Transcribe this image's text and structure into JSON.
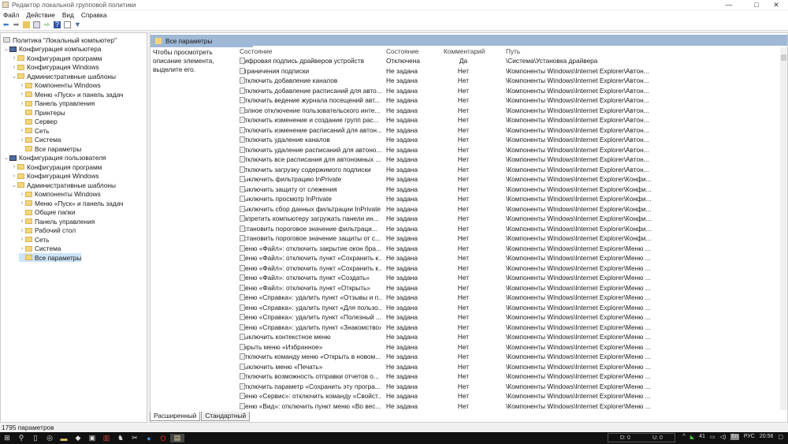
{
  "window": {
    "title": "Редактор локальной групповой политики",
    "minimize": "—",
    "maximize": "□",
    "close": "✕"
  },
  "menu": [
    "Файл",
    "Действие",
    "Вид",
    "Справка"
  ],
  "toolbar": {
    "icons": [
      "back-icon",
      "forward-icon",
      "up-folder-icon",
      "show-hide-tree-icon",
      "export-icon",
      "help-icon",
      "properties-icon",
      "filter-icon"
    ]
  },
  "tree": [
    {
      "label": "Политика \"Локальный компьютер\"",
      "level": 0,
      "arrow": ""
    },
    {
      "label": "Конфигурация компьютера",
      "level": 0,
      "arrow": "⌄"
    },
    {
      "label": "Конфигурация программ",
      "level": 1,
      "arrow": "›"
    },
    {
      "label": "Конфигурация Windows",
      "level": 1,
      "arrow": "›"
    },
    {
      "label": "Административные шаблоны",
      "level": 1,
      "arrow": "⌄"
    },
    {
      "label": "Компоненты Windows",
      "level": 2,
      "arrow": "›"
    },
    {
      "label": "Меню «Пуск» и панель задач",
      "level": 2,
      "arrow": "›"
    },
    {
      "label": "Панель управления",
      "level": 2,
      "arrow": "›"
    },
    {
      "label": "Принтеры",
      "level": 2,
      "arrow": ""
    },
    {
      "label": "Сервер",
      "level": 2,
      "arrow": ""
    },
    {
      "label": "Сеть",
      "level": 2,
      "arrow": "›"
    },
    {
      "label": "Система",
      "level": 2,
      "arrow": "›"
    },
    {
      "label": "Все параметры",
      "level": 2,
      "arrow": ""
    },
    {
      "label": "Конфигурация пользователя",
      "level": 0,
      "arrow": "⌄"
    },
    {
      "label": "Конфигурация программ",
      "level": 1,
      "arrow": "›"
    },
    {
      "label": "Конфигурация Windows",
      "level": 1,
      "arrow": "›"
    },
    {
      "label": "Административные шаблоны",
      "level": 1,
      "arrow": "⌄"
    },
    {
      "label": "Компоненты Windows",
      "level": 2,
      "arrow": "›"
    },
    {
      "label": "Меню «Пуск» и панель задач",
      "level": 2,
      "arrow": "›"
    },
    {
      "label": "Общие папки",
      "level": 2,
      "arrow": ""
    },
    {
      "label": "Панель управления",
      "level": 2,
      "arrow": "›"
    },
    {
      "label": "Рабочий стол",
      "level": 2,
      "arrow": "›"
    },
    {
      "label": "Сеть",
      "level": 2,
      "arrow": "›"
    },
    {
      "label": "Система",
      "level": 2,
      "arrow": "›"
    },
    {
      "label": "Все параметры",
      "level": 2,
      "arrow": "",
      "selected": true
    }
  ],
  "panel": {
    "header": "Все параметры",
    "description": "Чтобы просмотреть описание элемента, выделите его."
  },
  "columns": [
    "Состояние",
    "Состояние",
    "Комментарий",
    "Путь"
  ],
  "rows": [
    [
      "Цифровая подпись драйверов устройств",
      "Отключена",
      "Да",
      "\\Система\\Установка драйвера"
    ],
    [
      "Ограничения подписки",
      "Не задана",
      "Нет",
      "\\Компоненты Windows\\Internet Explorer\\Автон..."
    ],
    [
      "Отключить добавление каналов",
      "Не задана",
      "Нет",
      "\\Компоненты Windows\\Internet Explorer\\Автон..."
    ],
    [
      "Отключить добавление расписаний для авто...",
      "Не задана",
      "Нет",
      "\\Компоненты Windows\\Internet Explorer\\Автон..."
    ],
    [
      "Отключить ведение журнала посещений авт...",
      "Не задана",
      "Нет",
      "\\Компоненты Windows\\Internet Explorer\\Автон..."
    ],
    [
      "Полное отключение пользовательского инте...",
      "Не задана",
      "Нет",
      "\\Компоненты Windows\\Internet Explorer\\Автон..."
    ],
    [
      "Отключить изменение и создание групп рас...",
      "Не задана",
      "Нет",
      "\\Компоненты Windows\\Internet Explorer\\Автон..."
    ],
    [
      "Отключить изменение расписаний для автон...",
      "Не задана",
      "Нет",
      "\\Компоненты Windows\\Internet Explorer\\Автон..."
    ],
    [
      "Отключить удаление каналов",
      "Не задана",
      "Нет",
      "\\Компоненты Windows\\Internet Explorer\\Автон..."
    ],
    [
      "Отключить удаление расписаний для автоно...",
      "Не задана",
      "Нет",
      "\\Компоненты Windows\\Internet Explorer\\Автон..."
    ],
    [
      "Отключить все расписания для автономных ...",
      "Не задана",
      "Нет",
      "\\Компоненты Windows\\Internet Explorer\\Автон..."
    ],
    [
      "Отключить загрузку содержимого подписки",
      "Не задана",
      "Нет",
      "\\Компоненты Windows\\Internet Explorer\\Автон..."
    ],
    [
      "Выключить фильтрацию InPrivate",
      "Не задана",
      "Нет",
      "\\Компоненты Windows\\Internet Explorer\\Конфи..."
    ],
    [
      "Выключить защиту от слежения",
      "Не задана",
      "Нет",
      "\\Компоненты Windows\\Internet Explorer\\Конфи..."
    ],
    [
      "Выключить просмотр InPrivate",
      "Не задана",
      "Нет",
      "\\Компоненты Windows\\Internet Explorer\\Конфи..."
    ],
    [
      "Выключить сбор данных фильтрации InPrivate",
      "Не задана",
      "Нет",
      "\\Компоненты Windows\\Internet Explorer\\Конфи..."
    ],
    [
      "Запретить компьютеру загружать панели ин...",
      "Не задана",
      "Нет",
      "\\Компоненты Windows\\Internet Explorer\\Конфи..."
    ],
    [
      "Установить пороговое значение фильтраци...",
      "Не задана",
      "Нет",
      "\\Компоненты Windows\\Internet Explorer\\Конфи..."
    ],
    [
      "Установить пороговое значение защиты от с...",
      "Не задана",
      "Нет",
      "\\Компоненты Windows\\Internet Explorer\\Конфи..."
    ],
    [
      "Меню «Файл»: отключить закрытие окон бра...",
      "Не задана",
      "Нет",
      "\\Компоненты Windows\\Internet Explorer\\Меню ..."
    ],
    [
      "Меню «Файл»: отключить пункт «Сохранить к...",
      "Не задана",
      "Нет",
      "\\Компоненты Windows\\Internet Explorer\\Меню ..."
    ],
    [
      "Меню «Файл»: отключить пункт «Сохранить к...",
      "Не задана",
      "Нет",
      "\\Компоненты Windows\\Internet Explorer\\Меню ..."
    ],
    [
      "Меню «Файл»: отключить пункт «Создать»",
      "Не задана",
      "Нет",
      "\\Компоненты Windows\\Internet Explorer\\Меню ..."
    ],
    [
      "Меню «Файл»: отключить пункт «Открыть»",
      "Не задана",
      "Нет",
      "\\Компоненты Windows\\Internet Explorer\\Меню ..."
    ],
    [
      "Меню «Справка»: удалить пункт «Отзывы и п...",
      "Не задана",
      "Нет",
      "\\Компоненты Windows\\Internet Explorer\\Меню ..."
    ],
    [
      "Меню «Справка»: удалить пункт «Для пользо...",
      "Не задана",
      "Нет",
      "\\Компоненты Windows\\Internet Explorer\\Меню ..."
    ],
    [
      "Меню «Справка»: удалить пункт «Полезный ...",
      "Не задана",
      "Нет",
      "\\Компоненты Windows\\Internet Explorer\\Меню ..."
    ],
    [
      "Меню «Справка»: удалить пункт «Знакомство»",
      "Не задана",
      "Нет",
      "\\Компоненты Windows\\Internet Explorer\\Меню ..."
    ],
    [
      "Выключить контекстное меню",
      "Не задана",
      "Нет",
      "\\Компоненты Windows\\Internet Explorer\\Меню ..."
    ],
    [
      "Скрыть меню «Избранное»",
      "Не задана",
      "Нет",
      "\\Компоненты Windows\\Internet Explorer\\Меню ..."
    ],
    [
      "Отключить команду меню «Открыть в новом...",
      "Не задана",
      "Нет",
      "\\Компоненты Windows\\Internet Explorer\\Меню ..."
    ],
    [
      "Выключить меню «Печать»",
      "Не задана",
      "Нет",
      "\\Компоненты Windows\\Internet Explorer\\Меню ..."
    ],
    [
      "Отключить возможность отправки отчетов о...",
      "Не задана",
      "Нет",
      "\\Компоненты Windows\\Internet Explorer\\Меню ..."
    ],
    [
      "Отключить параметр «Сохранить эту програ...",
      "Не задана",
      "Нет",
      "\\Компоненты Windows\\Internet Explorer\\Меню ..."
    ],
    [
      "Меню «Сервис»: отключить команду «Свойст...",
      "Не задана",
      "Нет",
      "\\Компоненты Windows\\Internet Explorer\\Меню ..."
    ],
    [
      "Меню «Вид»: отключить пункт меню «Во вес...",
      "Не задана",
      "Нет",
      "\\Компоненты Windows\\Internet Explorer\\Меню ..."
    ]
  ],
  "tabs": [
    "Расширенный",
    "Стандартный"
  ],
  "status": "1795 параметров",
  "taskbar": {
    "net_down": "D: 0",
    "net_up": "U: 0",
    "tray_count": "41",
    "lang": "РУС",
    "time": "20:56"
  }
}
